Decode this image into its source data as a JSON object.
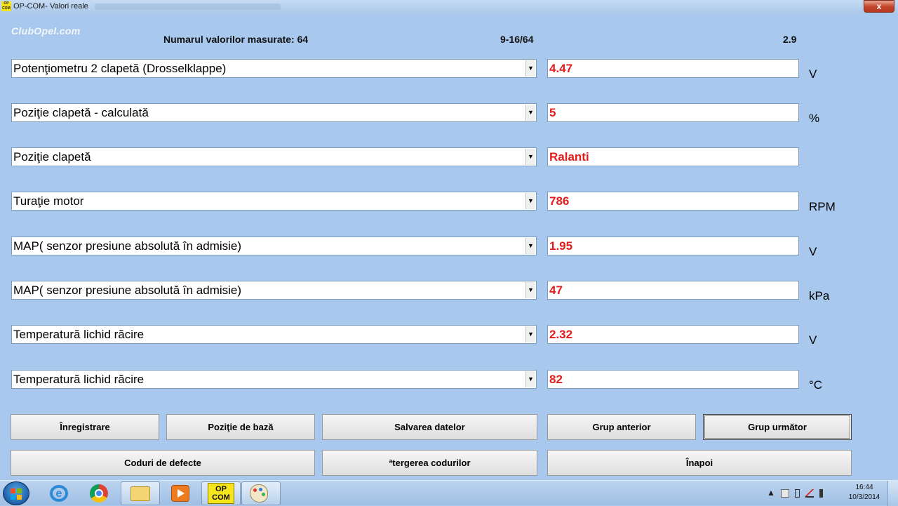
{
  "window": {
    "app_icon_text": "OP COM",
    "title": "OP-COM- Valori reale",
    "close_glyph": "x"
  },
  "header": {
    "logo": "ClubOpel.com",
    "count_text": "Numarul valorilor masurate: 64",
    "range_text": "9-16/64",
    "refresh_value": "2.9"
  },
  "rows": [
    {
      "param": "Potenţiometru 2 clapetă (Drosselklappe)",
      "value": "4.47",
      "unit": "V"
    },
    {
      "param": "Poziţie clapetă - calculată",
      "value": "5",
      "unit": "%"
    },
    {
      "param": "Poziţie clapetă",
      "value": "Ralanti",
      "unit": ""
    },
    {
      "param": "Turaţie motor",
      "value": "786",
      "unit": "RPM"
    },
    {
      "param": "MAP( senzor presiune absolută în admisie)",
      "value": "1.95",
      "unit": "V"
    },
    {
      "param": "MAP( senzor presiune absolută în admisie)",
      "value": "47",
      "unit": "kPa"
    },
    {
      "param": "Temperatură lichid răcire",
      "value": "2.32",
      "unit": "V"
    },
    {
      "param": "Temperatură lichid răcire",
      "value": "82",
      "unit": "°C"
    }
  ],
  "buttons": {
    "record": "Înregistrare",
    "base_position": "Poziţie de bază",
    "save_data": "Salvarea datelor",
    "prev_group": "Grup anterior",
    "next_group": "Grup următor",
    "fault_codes": "Coduri de defecte",
    "clear_codes": "ªtergerea codurilor",
    "back": "Înapoi"
  },
  "taskbar": {
    "opcom_icon_text": "OP COM",
    "tray_arrow": "▲",
    "time": "16:44",
    "date": "10/3/2014"
  },
  "colors": {
    "background": "#a8c8ee",
    "value_text": "#e31c1c"
  }
}
